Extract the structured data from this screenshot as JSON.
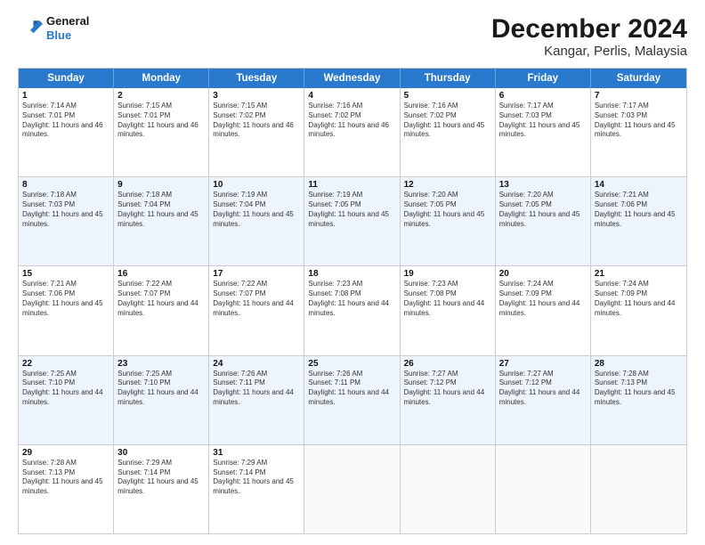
{
  "logo": {
    "general": "General",
    "blue": "Blue"
  },
  "title": "December 2024",
  "subtitle": "Kangar, Perlis, Malaysia",
  "days": [
    "Sunday",
    "Monday",
    "Tuesday",
    "Wednesday",
    "Thursday",
    "Friday",
    "Saturday"
  ],
  "weeks": [
    [
      {
        "num": "1",
        "sunrise": "7:14 AM",
        "sunset": "7:01 PM",
        "daylight": "11 hours and 46 minutes."
      },
      {
        "num": "2",
        "sunrise": "7:15 AM",
        "sunset": "7:01 PM",
        "daylight": "11 hours and 46 minutes."
      },
      {
        "num": "3",
        "sunrise": "7:15 AM",
        "sunset": "7:02 PM",
        "daylight": "11 hours and 46 minutes."
      },
      {
        "num": "4",
        "sunrise": "7:16 AM",
        "sunset": "7:02 PM",
        "daylight": "11 hours and 46 minutes."
      },
      {
        "num": "5",
        "sunrise": "7:16 AM",
        "sunset": "7:02 PM",
        "daylight": "11 hours and 45 minutes."
      },
      {
        "num": "6",
        "sunrise": "7:17 AM",
        "sunset": "7:03 PM",
        "daylight": "11 hours and 45 minutes."
      },
      {
        "num": "7",
        "sunrise": "7:17 AM",
        "sunset": "7:03 PM",
        "daylight": "11 hours and 45 minutes."
      }
    ],
    [
      {
        "num": "8",
        "sunrise": "7:18 AM",
        "sunset": "7:03 PM",
        "daylight": "11 hours and 45 minutes."
      },
      {
        "num": "9",
        "sunrise": "7:18 AM",
        "sunset": "7:04 PM",
        "daylight": "11 hours and 45 minutes."
      },
      {
        "num": "10",
        "sunrise": "7:19 AM",
        "sunset": "7:04 PM",
        "daylight": "11 hours and 45 minutes."
      },
      {
        "num": "11",
        "sunrise": "7:19 AM",
        "sunset": "7:05 PM",
        "daylight": "11 hours and 45 minutes."
      },
      {
        "num": "12",
        "sunrise": "7:20 AM",
        "sunset": "7:05 PM",
        "daylight": "11 hours and 45 minutes."
      },
      {
        "num": "13",
        "sunrise": "7:20 AM",
        "sunset": "7:05 PM",
        "daylight": "11 hours and 45 minutes."
      },
      {
        "num": "14",
        "sunrise": "7:21 AM",
        "sunset": "7:06 PM",
        "daylight": "11 hours and 45 minutes."
      }
    ],
    [
      {
        "num": "15",
        "sunrise": "7:21 AM",
        "sunset": "7:06 PM",
        "daylight": "11 hours and 45 minutes."
      },
      {
        "num": "16",
        "sunrise": "7:22 AM",
        "sunset": "7:07 PM",
        "daylight": "11 hours and 44 minutes."
      },
      {
        "num": "17",
        "sunrise": "7:22 AM",
        "sunset": "7:07 PM",
        "daylight": "11 hours and 44 minutes."
      },
      {
        "num": "18",
        "sunrise": "7:23 AM",
        "sunset": "7:08 PM",
        "daylight": "11 hours and 44 minutes."
      },
      {
        "num": "19",
        "sunrise": "7:23 AM",
        "sunset": "7:08 PM",
        "daylight": "11 hours and 44 minutes."
      },
      {
        "num": "20",
        "sunrise": "7:24 AM",
        "sunset": "7:09 PM",
        "daylight": "11 hours and 44 minutes."
      },
      {
        "num": "21",
        "sunrise": "7:24 AM",
        "sunset": "7:09 PM",
        "daylight": "11 hours and 44 minutes."
      }
    ],
    [
      {
        "num": "22",
        "sunrise": "7:25 AM",
        "sunset": "7:10 PM",
        "daylight": "11 hours and 44 minutes."
      },
      {
        "num": "23",
        "sunrise": "7:25 AM",
        "sunset": "7:10 PM",
        "daylight": "11 hours and 44 minutes."
      },
      {
        "num": "24",
        "sunrise": "7:26 AM",
        "sunset": "7:11 PM",
        "daylight": "11 hours and 44 minutes."
      },
      {
        "num": "25",
        "sunrise": "7:26 AM",
        "sunset": "7:11 PM",
        "daylight": "11 hours and 44 minutes."
      },
      {
        "num": "26",
        "sunrise": "7:27 AM",
        "sunset": "7:12 PM",
        "daylight": "11 hours and 44 minutes."
      },
      {
        "num": "27",
        "sunrise": "7:27 AM",
        "sunset": "7:12 PM",
        "daylight": "11 hours and 44 minutes."
      },
      {
        "num": "28",
        "sunrise": "7:28 AM",
        "sunset": "7:13 PM",
        "daylight": "11 hours and 45 minutes."
      }
    ],
    [
      {
        "num": "29",
        "sunrise": "7:28 AM",
        "sunset": "7:13 PM",
        "daylight": "11 hours and 45 minutes."
      },
      {
        "num": "30",
        "sunrise": "7:29 AM",
        "sunset": "7:14 PM",
        "daylight": "11 hours and 45 minutes."
      },
      {
        "num": "31",
        "sunrise": "7:29 AM",
        "sunset": "7:14 PM",
        "daylight": "11 hours and 45 minutes."
      },
      null,
      null,
      null,
      null
    ]
  ],
  "labels": {
    "sunrise": "Sunrise:",
    "sunset": "Sunset:",
    "daylight": "Daylight:"
  }
}
